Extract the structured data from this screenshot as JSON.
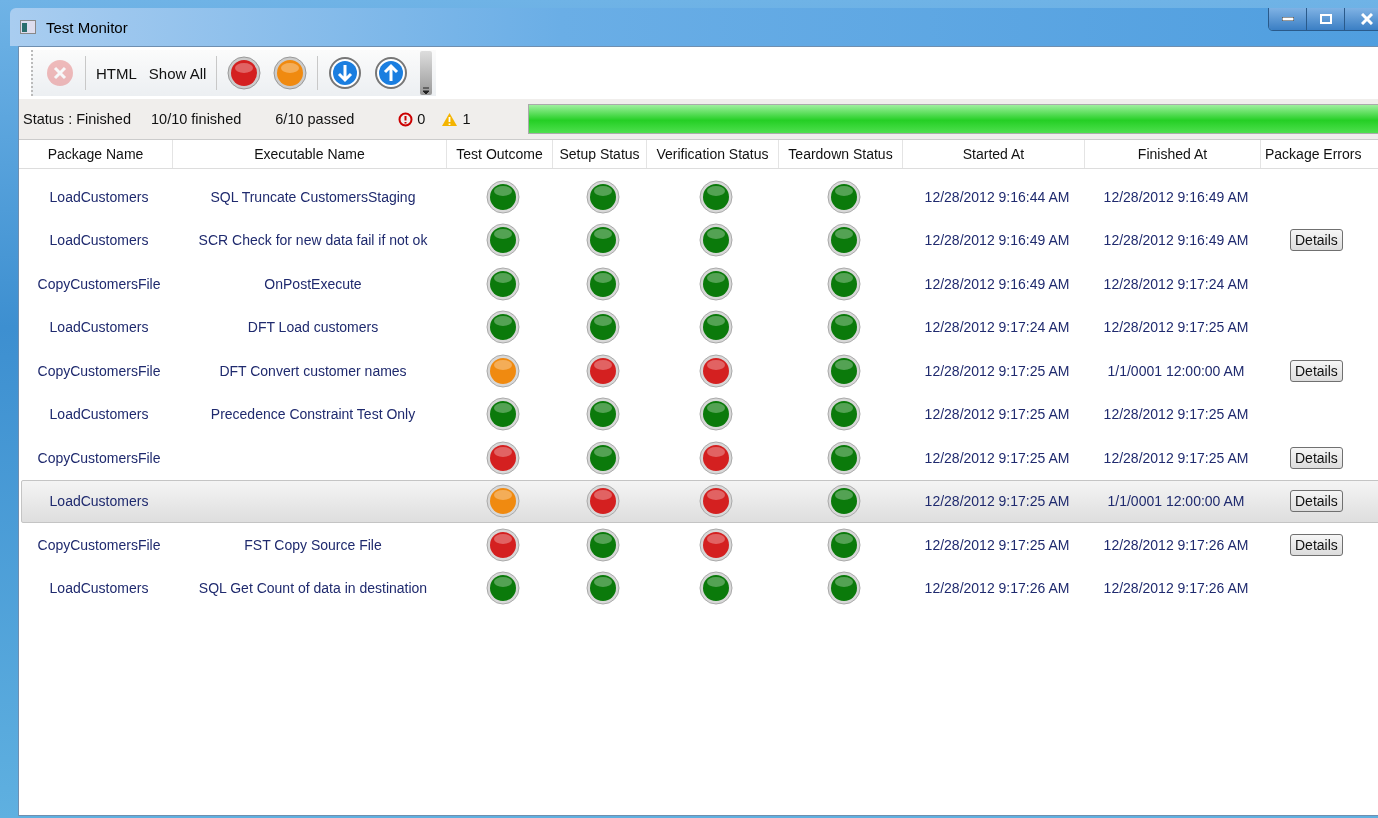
{
  "window": {
    "title": "Test Monitor"
  },
  "toolbar": [
    {
      "kind": "cancel",
      "disabled": true
    },
    {
      "kind": "text",
      "label": "HTML"
    },
    {
      "kind": "text",
      "label": "Show All"
    },
    {
      "kind": "filter",
      "color": "#d42020"
    },
    {
      "kind": "filter",
      "color": "#f08a10"
    },
    {
      "kind": "down"
    },
    {
      "kind": "up"
    }
  ],
  "status_bar": {
    "status": "Status : Finished",
    "finished": "10/10 finished",
    "passed": "6/10 passed",
    "errors": "0",
    "warnings": "1",
    "level": 1
  },
  "table": {
    "columns": [
      "Package Name",
      "Executable Name",
      "Test Outcome",
      "Setup Status",
      "Verification Status",
      "Teardown Status",
      "Started At",
      "Finished At",
      "Package Errors"
    ],
    "rows": [
      {
        "package": "LoadCustomers",
        "executable": "SQL Truncate CustomersStaging",
        "test_outcome": {
          "color": "#0b7a0b"
        },
        "setup": {
          "color": "#0b7a0b"
        },
        "verification": {
          "color": "#0b7a0b"
        },
        "teardown": {
          "color": "#0b7a0b"
        },
        "started": "12/28/2012 9:16:44 AM",
        "finished": "12/28/2012 9:16:49 AM",
        "selected": false
      },
      {
        "package": "LoadCustomers",
        "executable": "SCR Check for new data fail if not ok",
        "test_outcome": {
          "color": "#0b7a0b"
        },
        "setup": {
          "color": "#0b7a0b"
        },
        "verification": {
          "color": "#0b7a0b"
        },
        "teardown": {
          "color": "#0b7a0b"
        },
        "started": "12/28/2012 9:16:49 AM",
        "finished": "12/28/2012 9:16:49 AM",
        "errors_button": "Details",
        "selected": false
      },
      {
        "package": "CopyCustomersFile",
        "executable": "OnPostExecute",
        "test_outcome": {
          "color": "#0b7a0b"
        },
        "setup": {
          "color": "#0b7a0b"
        },
        "verification": {
          "color": "#0b7a0b"
        },
        "teardown": {
          "color": "#0b7a0b"
        },
        "started": "12/28/2012 9:16:49 AM",
        "finished": "12/28/2012 9:17:24 AM",
        "selected": false
      },
      {
        "package": "LoadCustomers",
        "executable": "DFT Load customers",
        "test_outcome": {
          "color": "#0b7a0b"
        },
        "setup": {
          "color": "#0b7a0b"
        },
        "verification": {
          "color": "#0b7a0b"
        },
        "teardown": {
          "color": "#0b7a0b"
        },
        "started": "12/28/2012 9:17:24 AM",
        "finished": "12/28/2012 9:17:25 AM",
        "selected": false
      },
      {
        "package": "CopyCustomersFile",
        "executable": "DFT Convert customer names",
        "test_outcome": {
          "color": "#f08a10"
        },
        "setup": {
          "color": "#d42020"
        },
        "verification": {
          "color": "#d42020"
        },
        "teardown": {
          "color": "#0b7a0b"
        },
        "started": "12/28/2012 9:17:25 AM",
        "finished": "1/1/0001 12:00:00 AM",
        "errors_button": "Details",
        "selected": false
      },
      {
        "package": "LoadCustomers",
        "executable": "Precedence Constraint Test Only",
        "test_outcome": {
          "color": "#0b7a0b"
        },
        "setup": {
          "color": "#0b7a0b"
        },
        "verification": {
          "color": "#0b7a0b"
        },
        "teardown": {
          "color": "#0b7a0b"
        },
        "started": "12/28/2012 9:17:25 AM",
        "finished": "12/28/2012 9:17:25 AM",
        "selected": false
      },
      {
        "package": "CopyCustomersFile",
        "test_outcome": {
          "color": "#d42020"
        },
        "setup": {
          "color": "#0b7a0b"
        },
        "verification": {
          "color": "#d42020"
        },
        "teardown": {
          "color": "#0b7a0b"
        },
        "started": "12/28/2012 9:17:25 AM",
        "finished": "12/28/2012 9:17:25 AM",
        "errors_button": "Details",
        "selected": false
      },
      {
        "package": "LoadCustomers",
        "test_outcome": {
          "color": "#f08a10"
        },
        "setup": {
          "color": "#d42020"
        },
        "verification": {
          "color": "#d42020"
        },
        "teardown": {
          "color": "#0b7a0b"
        },
        "started": "12/28/2012 9:17:25 AM",
        "finished": "1/1/0001 12:00:00 AM",
        "errors_button": "Details",
        "selected": true
      },
      {
        "package": "CopyCustomersFile",
        "executable": "FST Copy Source File",
        "test_outcome": {
          "color": "#d42020"
        },
        "setup": {
          "color": "#0b7a0b"
        },
        "verification": {
          "color": "#d42020"
        },
        "teardown": {
          "color": "#0b7a0b"
        },
        "started": "12/28/2012 9:17:25 AM",
        "finished": "12/28/2012 9:17:26 AM",
        "errors_button": "Details",
        "selected": false
      },
      {
        "package": "LoadCustomers",
        "executable": "SQL Get Count of data in destination",
        "test_outcome": {
          "color": "#0b7a0b"
        },
        "setup": {
          "color": "#0b7a0b"
        },
        "verification": {
          "color": "#0b7a0b"
        },
        "teardown": {
          "color": "#0b7a0b"
        },
        "started": "12/28/2012 9:17:26 AM",
        "finished": "12/28/2012 9:17:26 AM",
        "selected": false
      }
    ]
  }
}
